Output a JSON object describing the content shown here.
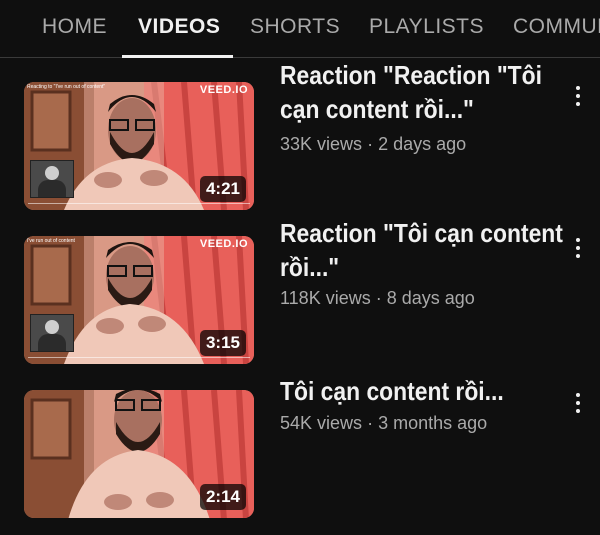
{
  "tabs": [
    {
      "label": "HOME"
    },
    {
      "label": "VIDEOS"
    },
    {
      "label": "SHORTS"
    },
    {
      "label": "PLAYLISTS"
    },
    {
      "label": "COMMUN"
    }
  ],
  "active_tab": "VIDEOS",
  "videos": [
    {
      "title_line1": "Reaction \"Reaction \"Tôi",
      "title_line2": "cạn content rồi...\"",
      "views": "33K views",
      "age": "2 days ago",
      "duration": "4:21",
      "brand": "VEED",
      "caption": "Reacting to \"I've run out of content\""
    },
    {
      "title_line1": "Reaction \"Tôi cạn content",
      "title_line2": "rồi...\"",
      "views": "118K views",
      "age": "8 days ago",
      "duration": "3:15",
      "brand": "VEED",
      "caption": "I've run out of content"
    },
    {
      "title_line1": "Tôi cạn content rồi...",
      "title_line2": "",
      "views": "54K views",
      "age": "3 months ago",
      "duration": "2:14"
    }
  ],
  "meta_separator": "·",
  "colors": {
    "background": "#0f0f0f",
    "text_primary": "#f1f1f1",
    "text_secondary": "#aaaaaa",
    "curtain": "#e8605a",
    "shirt": "#f0c8b8"
  }
}
